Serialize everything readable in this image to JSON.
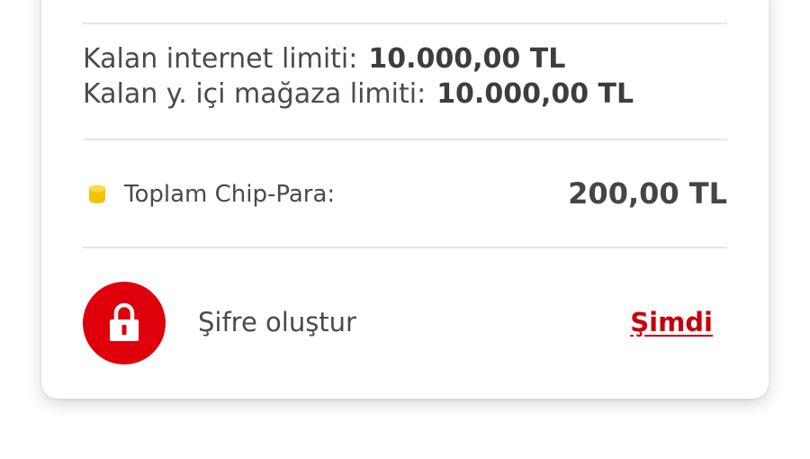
{
  "limits": {
    "internet_label": "Kalan internet limiti:",
    "internet_value": "10.000,00 TL",
    "store_label": "Kalan y. içi mağaza limiti:",
    "store_value": "10.000,00 TL"
  },
  "chip_para": {
    "icon": "coins-icon",
    "label": "Toplam Chip-Para:",
    "value": "200,00 TL"
  },
  "password": {
    "icon": "lock-icon",
    "label": "Şifre oluştur",
    "action_label": "Şimdi"
  },
  "colors": {
    "accent_red": "#e0000b",
    "link_red": "#c8000a",
    "coin_yellow": "#f2c400",
    "divider": "#e6e6e6",
    "text": "#4a4a4a"
  }
}
